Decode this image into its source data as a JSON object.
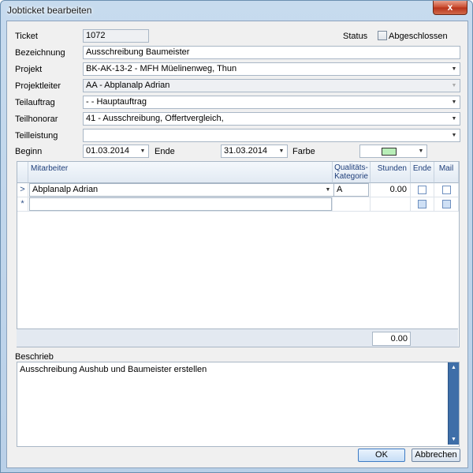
{
  "window": {
    "title": "Jobticket bearbeiten",
    "close_label": "x"
  },
  "form": {
    "ticket": {
      "label": "Ticket",
      "value": "1072"
    },
    "status": {
      "label": "Status",
      "checkbox_label": "Abgeschlossen",
      "checked": false
    },
    "bezeichnung": {
      "label": "Bezeichnung",
      "value": "Ausschreibung Baumeister"
    },
    "projekt": {
      "label": "Projekt",
      "value": "BK-AK-13-2 - MFH Müelinenweg, Thun"
    },
    "projektleiter": {
      "label": "Projektleiter",
      "value": "AA - Abplanalp Adrian"
    },
    "teilauftrag": {
      "label": "Teilauftrag",
      "value": "- - Hauptauftrag"
    },
    "teilhonorar": {
      "label": "Teilhonorar",
      "value": "41 - Ausschreibung, Offertvergleich,"
    },
    "teilleistung": {
      "label": "Teilleistung",
      "value": ""
    },
    "beginn": {
      "label": "Beginn",
      "value": "01.03.2014"
    },
    "ende": {
      "label": "Ende",
      "value": "31.03.2014"
    },
    "farbe": {
      "label": "Farbe",
      "color": "#b8eeb8"
    }
  },
  "grid": {
    "columns": {
      "mitarbeiter": "Mitarbeiter",
      "kategorie_1": "Qualitäts-",
      "kategorie_2": "Kategorie",
      "stunden": "Stunden",
      "ende": "Ende",
      "mail": "Mail"
    },
    "rows": [
      {
        "mitarbeiter": "Abplanalp Adrian",
        "kategorie": "A",
        "stunden": "0.00"
      }
    ],
    "row_indicator": ">",
    "new_row_indicator": "*",
    "total": "0.00"
  },
  "beschrieb": {
    "label": "Beschrieb",
    "value": "Ausschreibung Aushub und Baumeister erstellen"
  },
  "buttons": {
    "ok": "OK",
    "cancel": "Abbrechen"
  }
}
